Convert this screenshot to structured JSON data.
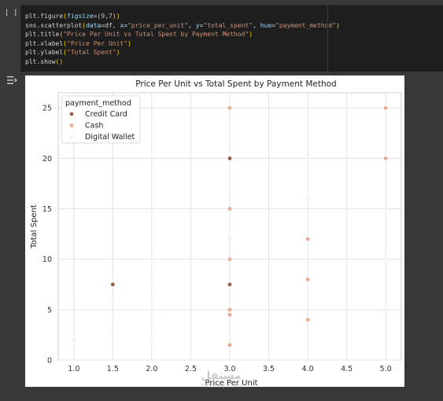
{
  "notebook": {
    "run_button": "[ ]",
    "code_lines": [
      [
        {
          "t": "plt.figure",
          "c": "kw"
        },
        {
          "t": "(",
          "c": "par"
        },
        {
          "t": "figsize",
          "c": "arg"
        },
        {
          "t": "=(",
          "c": "kw"
        },
        {
          "t": "9",
          "c": "num"
        },
        {
          "t": ",",
          "c": "kw"
        },
        {
          "t": "7",
          "c": "num"
        },
        {
          "t": "))",
          "c": "par"
        }
      ],
      [
        {
          "t": "sns.scatterplot",
          "c": "kw"
        },
        {
          "t": "(",
          "c": "par"
        },
        {
          "t": "data",
          "c": "arg"
        },
        {
          "t": "=df, ",
          "c": "kw"
        },
        {
          "t": "x",
          "c": "arg"
        },
        {
          "t": "=",
          "c": "kw"
        },
        {
          "t": "\"price_per_unit\"",
          "c": "str"
        },
        {
          "t": ", ",
          "c": "kw"
        },
        {
          "t": "y",
          "c": "arg"
        },
        {
          "t": "=",
          "c": "kw"
        },
        {
          "t": "\"total_spent\"",
          "c": "str"
        },
        {
          "t": ", ",
          "c": "kw"
        },
        {
          "t": "hue",
          "c": "arg"
        },
        {
          "t": "=",
          "c": "kw"
        },
        {
          "t": "\"payment_method\"",
          "c": "str"
        },
        {
          "t": ")",
          "c": "par"
        }
      ],
      [
        {
          "t": "plt.title",
          "c": "kw"
        },
        {
          "t": "(",
          "c": "par"
        },
        {
          "t": "\"Price Per Unit vs Total Spent by Payment Method\"",
          "c": "str"
        },
        {
          "t": ")",
          "c": "par"
        }
      ],
      [
        {
          "t": "plt.xlabel",
          "c": "kw"
        },
        {
          "t": "(",
          "c": "par"
        },
        {
          "t": "\"Price Per Unit\"",
          "c": "str"
        },
        {
          "t": ")",
          "c": "par"
        }
      ],
      [
        {
          "t": "plt.ylabel",
          "c": "kw"
        },
        {
          "t": "(",
          "c": "par"
        },
        {
          "t": "\"Total Spent\"",
          "c": "str"
        },
        {
          "t": ")",
          "c": "par"
        }
      ],
      [
        {
          "t": "plt.show",
          "c": "kw"
        },
        {
          "t": "()",
          "c": "par"
        }
      ]
    ],
    "output_icon": "output-toggle-icon",
    "watermark_big": "مستقل",
    "watermark_small": "mostaql.com"
  },
  "chart_data": {
    "type": "scatter",
    "title": "Price Per Unit vs Total Spent by Payment Method",
    "xlabel": "Price Per Unit",
    "ylabel": "Total Spent",
    "xlim": [
      0.8,
      5.2
    ],
    "ylim": [
      0,
      26.5
    ],
    "xticks": [
      "1.0",
      "1.5",
      "2.0",
      "2.5",
      "3.0",
      "3.5",
      "4.0",
      "4.5",
      "5.0"
    ],
    "yticks": [
      "0",
      "5",
      "10",
      "15",
      "20",
      "25"
    ],
    "grid": true,
    "legend": {
      "title": "payment_method",
      "placement": "top-left",
      "entries": [
        "Credit Card",
        "Cash",
        "Digital Wallet"
      ]
    },
    "colors": {
      "Credit Card": "#9c5a45",
      "Cash": "#e8ab8c",
      "Digital Wallet": "#fbf0ec"
    },
    "series": [
      {
        "name": "Credit Card",
        "points": [
          [
            1.5,
            7.5
          ],
          [
            3.0,
            20.0
          ],
          [
            3.0,
            7.5
          ]
        ]
      },
      {
        "name": "Cash",
        "points": [
          [
            3.0,
            25.0
          ],
          [
            3.0,
            15.0
          ],
          [
            3.0,
            10.0
          ],
          [
            3.0,
            5.0
          ],
          [
            3.0,
            4.5
          ],
          [
            3.0,
            1.5
          ],
          [
            4.0,
            12.0
          ],
          [
            4.0,
            8.0
          ],
          [
            4.0,
            4.0
          ],
          [
            5.0,
            25.0
          ],
          [
            5.0,
            20.0
          ]
        ]
      },
      {
        "name": "Digital Wallet",
        "points": [
          [
            1.0,
            5.0
          ],
          [
            1.0,
            4.0
          ],
          [
            1.0,
            3.0
          ],
          [
            1.0,
            2.0
          ],
          [
            1.0,
            1.0
          ],
          [
            1.5,
            6.0
          ],
          [
            1.5,
            4.5
          ],
          [
            1.5,
            3.0
          ],
          [
            1.5,
            1.5
          ],
          [
            2.0,
            10.0
          ],
          [
            2.0,
            8.0
          ],
          [
            2.0,
            6.0
          ],
          [
            2.0,
            4.0
          ],
          [
            2.0,
            2.0
          ],
          [
            3.0,
            16.0
          ],
          [
            3.0,
            12.0
          ],
          [
            3.0,
            9.0
          ],
          [
            3.0,
            6.0
          ],
          [
            3.0,
            3.0
          ],
          [
            4.0,
            20.0
          ],
          [
            4.0,
            16.0
          ],
          [
            5.0,
            15.0
          ],
          [
            5.0,
            10.0
          ],
          [
            5.0,
            5.0
          ]
        ]
      }
    ]
  }
}
